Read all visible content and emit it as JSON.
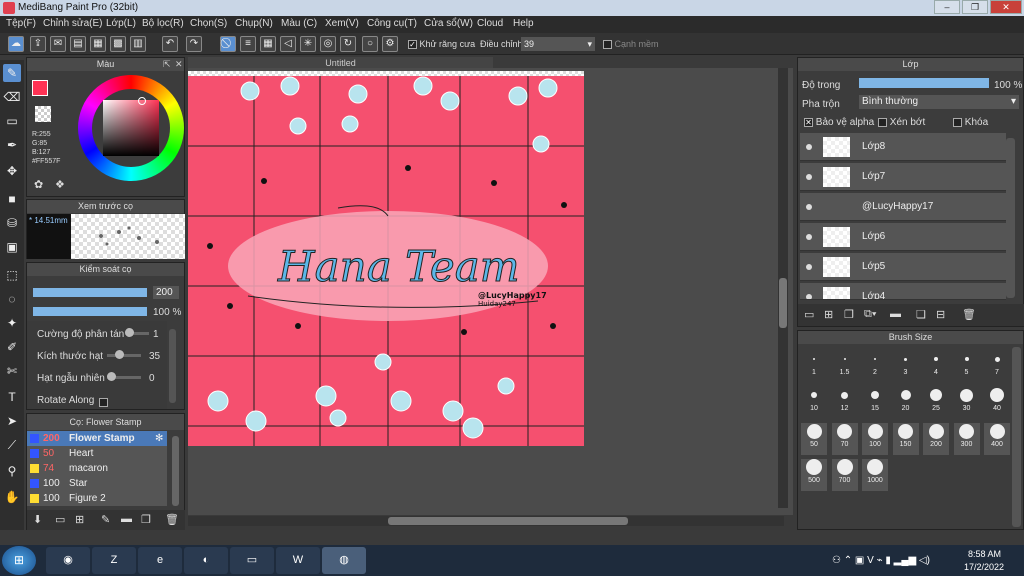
{
  "window": {
    "title": "MediBang Paint Pro (32bit)"
  },
  "menu": [
    "Tệp(F)",
    "Chỉnh sửa(E)",
    "Lớp(L)",
    "Bộ lọc(R)",
    "Chọn(S)",
    "Chụp(N)",
    "Màu (C)",
    "Xem(V)",
    "Công cụ(T)",
    "Cửa sổ(W)",
    "Cloud",
    "Help"
  ],
  "toolbar": {
    "antialias_label": "Khử răng cưa",
    "adjust_label": "Điều chỉnh",
    "adjust_value": "39",
    "snap_label": "Cạnh mềm"
  },
  "color_panel": {
    "title": "Màu",
    "r": "R:255",
    "g": "G:85",
    "b": "B:127",
    "hex": "#FF557F",
    "primary": "#FF3355"
  },
  "brush_preview": {
    "title": "Xem trước cọ",
    "size": "14.51mm"
  },
  "brush_control": {
    "title": "Kiểm soát cọ",
    "size_value": "200",
    "opacity_value": "100 %",
    "rows": [
      {
        "label": "Cường độ phân tán",
        "value": "1"
      },
      {
        "label": "Kích thước hạt",
        "value": "35"
      },
      {
        "label": "Hạt ngẫu nhiên",
        "value": "0"
      },
      {
        "label": "Rotate Along",
        "value": ""
      }
    ]
  },
  "brush_list": {
    "title": "Cọ: Flower Stamp",
    "items": [
      {
        "num": "200",
        "name": "Flower Stamp",
        "color": "#3355ff"
      },
      {
        "num": "50",
        "name": "Heart",
        "color": "#3355ff"
      },
      {
        "num": "74",
        "name": "macaron",
        "color": "#ffdd33"
      },
      {
        "num": "100",
        "name": "Star",
        "color": "#3355ff"
      },
      {
        "num": "100",
        "name": "Figure 2",
        "color": "#ffdd33"
      }
    ]
  },
  "document": {
    "tab": "Untitled",
    "lettering": "Hana Team",
    "credit1": "@LucyHappy17",
    "credit2": "Huiday247"
  },
  "layer_panel": {
    "title": "Lớp",
    "opacity_label": "Độ trong",
    "opacity_value": "100 %",
    "blend_label": "Pha trộn",
    "blend_value": "Bình thường",
    "protect_alpha": "Bảo vệ alpha",
    "clipping": "Xén bớt",
    "lock": "Khóa",
    "layers": [
      "Lớp8",
      "Lớp7",
      "@LucyHappy17",
      "Lớp6",
      "Lớp5",
      "Lớp4"
    ]
  },
  "brush_size": {
    "title": "Brush Size",
    "sizes": [
      "1",
      "1.5",
      "2",
      "3",
      "4",
      "5",
      "7",
      "10",
      "12",
      "15",
      "20",
      "25",
      "30",
      "40",
      "50",
      "70",
      "100",
      "150",
      "200",
      "300",
      "400",
      "500",
      "700",
      "1000"
    ]
  },
  "taskbar": {
    "apps": [
      "Chrome",
      "Zalo",
      "IE",
      "Coc Coc",
      "Explorer",
      "Word",
      "MediBang"
    ],
    "time": "8:58 AM",
    "date": "17/2/2022",
    "tray_v": "V"
  }
}
